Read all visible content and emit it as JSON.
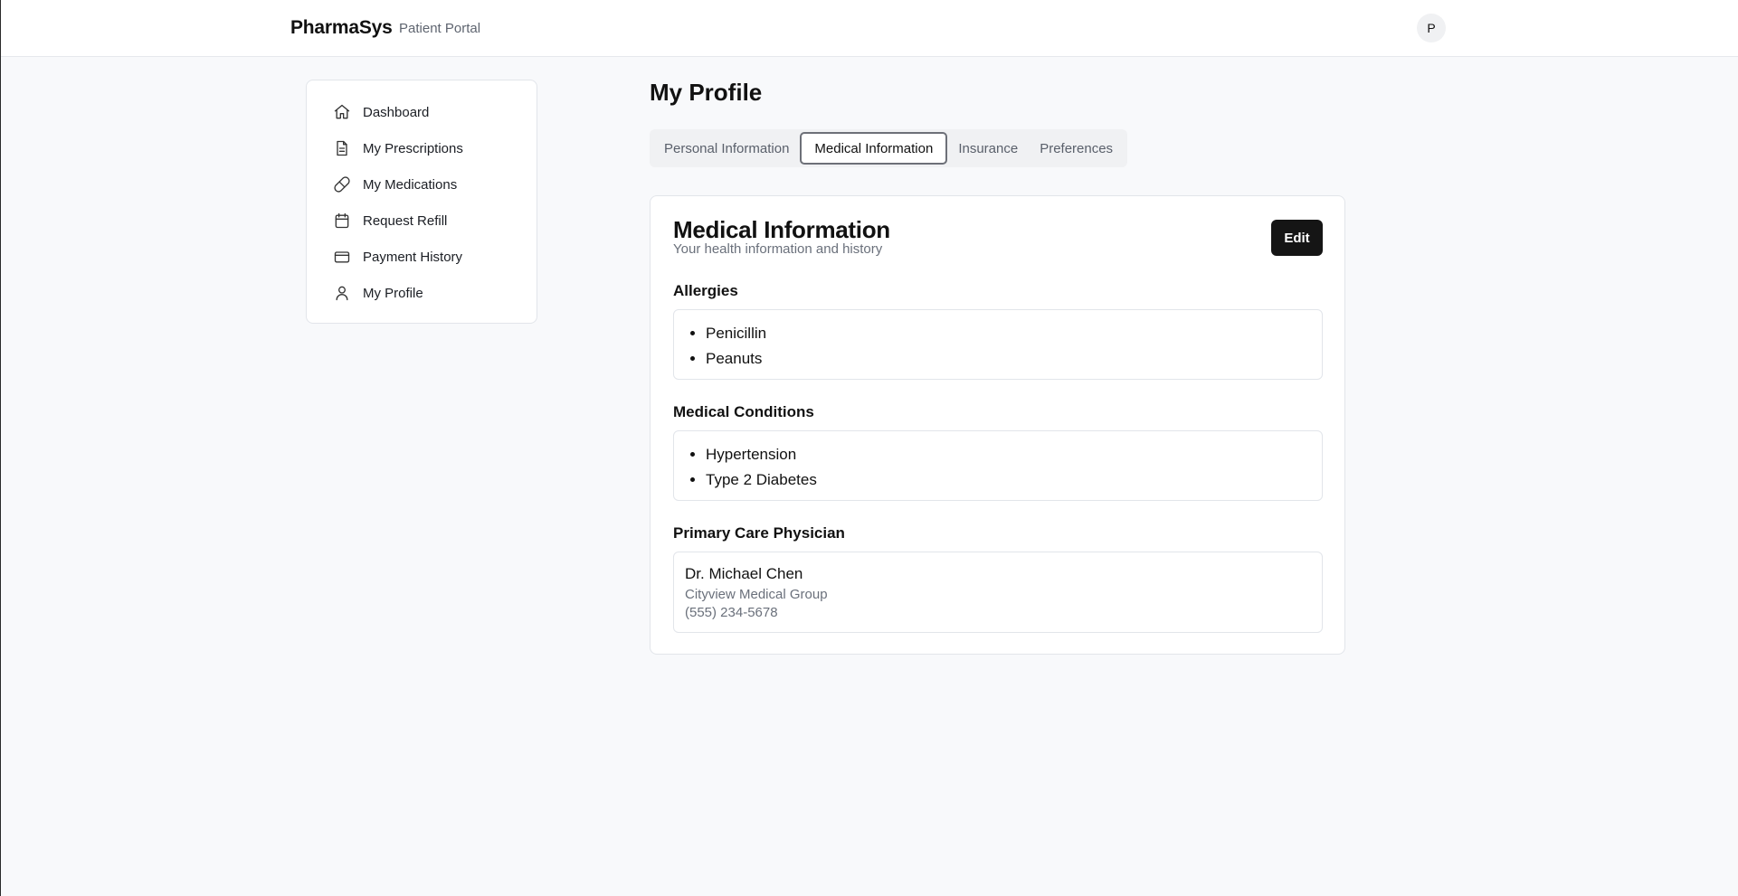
{
  "header": {
    "brand": "PharmaSys",
    "subtitle": "Patient Portal",
    "avatar_initial": "P"
  },
  "sidebar": {
    "items": [
      {
        "label": "Dashboard",
        "icon": "home-icon"
      },
      {
        "label": "My Prescriptions",
        "icon": "document-icon"
      },
      {
        "label": "My Medications",
        "icon": "pill-icon"
      },
      {
        "label": "Request Refill",
        "icon": "calendar-icon"
      },
      {
        "label": "Payment History",
        "icon": "credit-card-icon"
      },
      {
        "label": "My Profile",
        "icon": "user-icon"
      }
    ]
  },
  "main": {
    "title": "My Profile",
    "tabs": [
      {
        "label": "Personal Information",
        "active": false
      },
      {
        "label": "Medical Information",
        "active": true
      },
      {
        "label": "Insurance",
        "active": false
      },
      {
        "label": "Preferences",
        "active": false
      }
    ],
    "card": {
      "title": "Medical Information",
      "subtitle": "Your health information and history",
      "edit_label": "Edit",
      "allergies_label": "Allergies",
      "allergies": [
        "Penicillin",
        "Peanuts"
      ],
      "conditions_label": "Medical Conditions",
      "conditions": [
        "Hypertension",
        "Type 2 Diabetes"
      ],
      "physician_label": "Primary Care Physician",
      "physician": {
        "name": "Dr. Michael Chen",
        "organization": "Cityview Medical Group",
        "phone": "(555) 234-5678"
      }
    }
  }
}
